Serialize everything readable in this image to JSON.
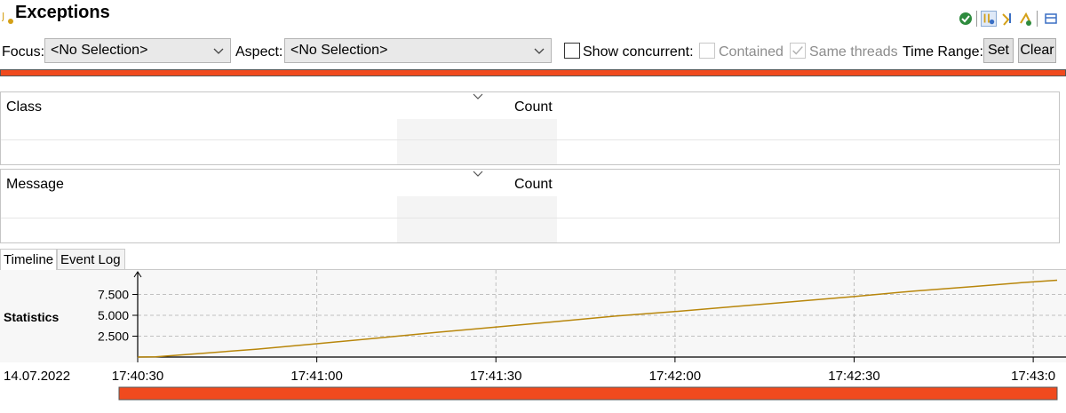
{
  "header": {
    "title": "Exceptions",
    "toolbar_icons": [
      "green-check-icon",
      "thread-filter-icon",
      "thread-aspect-icon",
      "thread-aspect-alt-icon",
      "view-menu-icon"
    ]
  },
  "filters": {
    "focus_label": "Focus:",
    "focus_value": "<No Selection>",
    "aspect_label": "Aspect:",
    "aspect_value": "<No Selection>",
    "show_concurrent_label": "Show concurrent:",
    "contained_label": "Contained",
    "same_threads_label": "Same threads",
    "time_range_label": "Time Range:",
    "set_label": "Set",
    "clear_label": "Clear"
  },
  "class_table": {
    "col1": "Class",
    "col2": "Count"
  },
  "message_table": {
    "col1": "Message",
    "col2": "Count"
  },
  "tabs": [
    {
      "label": "Timeline",
      "active": true
    },
    {
      "label": "Event Log",
      "active": false
    }
  ],
  "colors": {
    "accent_red": "#f04a1e",
    "line": "#b8860b",
    "green": "#2e8b3e"
  },
  "chart_data": {
    "type": "line",
    "row_label": "Statistics",
    "date_label": "14.07.2022",
    "y_ticks": [
      "2.500",
      "5.000",
      "7.500"
    ],
    "y_tick_values": [
      2500,
      5000,
      7500
    ],
    "ylim": [
      0,
      10000
    ],
    "x_ticks": [
      "17:40:30",
      "17:41:00",
      "17:41:30",
      "17:42:00",
      "17:42:30",
      "17:43:0"
    ],
    "x_tick_values": [
      0,
      30,
      60,
      90,
      120,
      150
    ],
    "xlim": [
      0,
      154
    ],
    "grid": true,
    "series": [
      {
        "x": [
          0,
          3,
          10,
          20,
          30,
          40,
          50,
          60,
          70,
          80,
          90,
          100,
          110,
          120,
          130,
          140,
          148,
          154
        ],
        "y": [
          0,
          30,
          400,
          950,
          1600,
          2250,
          2950,
          3600,
          4250,
          4900,
          5450,
          6050,
          6650,
          7250,
          7900,
          8450,
          8900,
          9200
        ]
      }
    ]
  }
}
